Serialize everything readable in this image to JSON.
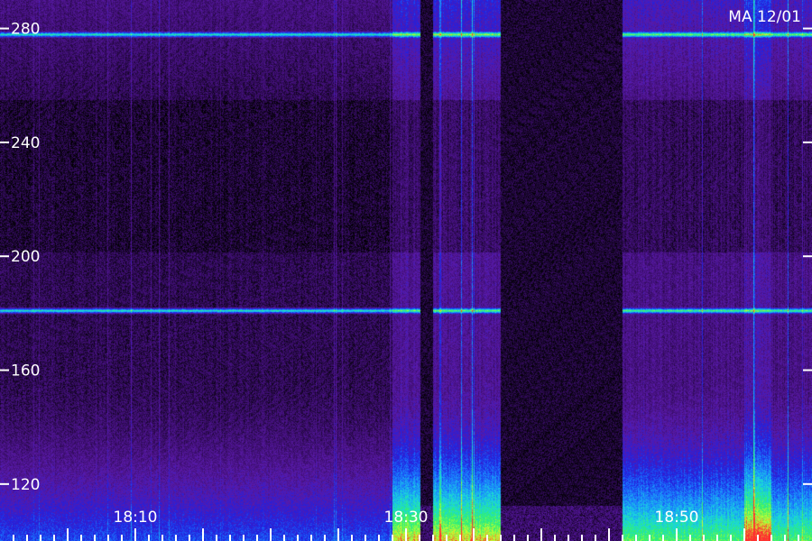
{
  "chart_data": {
    "type": "heatmap",
    "title": "",
    "station_label": "MA 12/01",
    "xlabel": "",
    "ylabel": "",
    "x_range": [
      "18:00",
      "19:00"
    ],
    "ylim": [
      100,
      290
    ],
    "y_ticks": [
      {
        "value": 280,
        "label": "280"
      },
      {
        "value": 240,
        "label": "240"
      },
      {
        "value": 200,
        "label": "200"
      },
      {
        "value": 160,
        "label": "160"
      },
      {
        "value": 120,
        "label": "120"
      }
    ],
    "x_ticks": [
      {
        "value": "18:10",
        "label": "18:10"
      },
      {
        "value": "18:30",
        "label": "18:30"
      },
      {
        "value": "18:50",
        "label": "18:50"
      }
    ],
    "colormap": [
      "#000000",
      "#3a0d6a",
      "#5a1aa8",
      "#2020e0",
      "#1a7cff",
      "#19d6e0",
      "#30f070",
      "#c8ff30",
      "#ff3030"
    ],
    "horizontal_lines": [
      {
        "y": 278,
        "strength": 0.55
      },
      {
        "y": 181,
        "strength": 0.6
      }
    ],
    "time_segments": [
      {
        "start": "18:00",
        "end": "18:29",
        "level": "low"
      },
      {
        "start": "18:29",
        "end": "18:31",
        "level": "high"
      },
      {
        "start": "18:31",
        "end": "18:32",
        "level": "dropout"
      },
      {
        "start": "18:32",
        "end": "18:37",
        "level": "high"
      },
      {
        "start": "18:37",
        "end": "18:46",
        "level": "dropout"
      },
      {
        "start": "18:46",
        "end": "18:55",
        "level": "medium"
      },
      {
        "start": "18:55",
        "end": "18:57",
        "level": "very-high"
      },
      {
        "start": "18:57",
        "end": "19:00",
        "level": "medium"
      }
    ]
  }
}
